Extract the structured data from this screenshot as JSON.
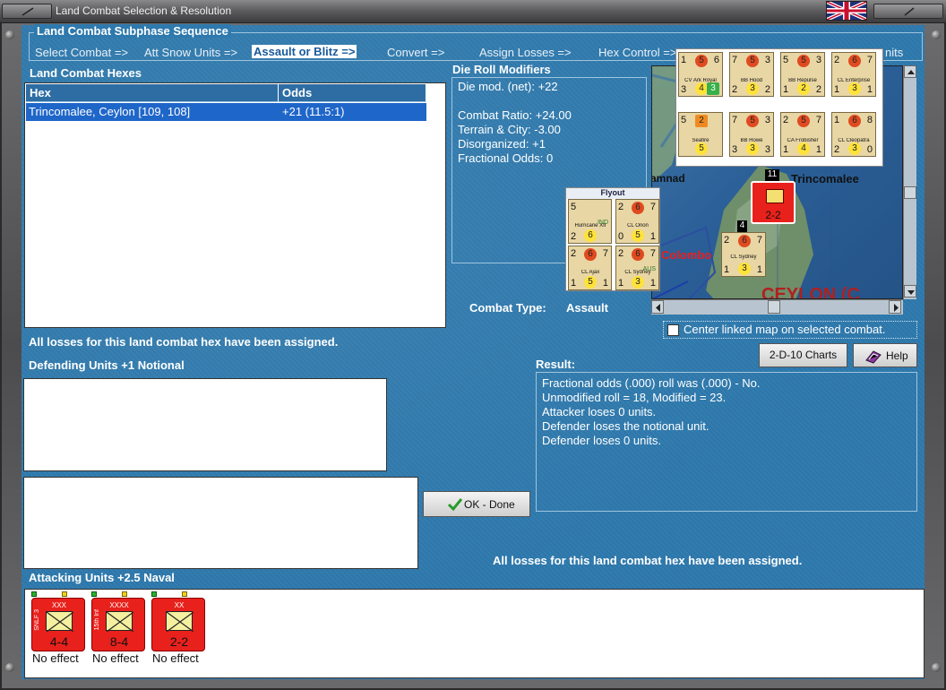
{
  "window": {
    "title": "Land Combat Selection & Resolution"
  },
  "subphase": {
    "title": "Land Combat Subphase Sequence",
    "steps": [
      "Select Combat =>",
      "Att Snow Units =>",
      "Assault or Blitz =>",
      "Convert =>",
      "Assign Losses =>",
      "Hex Control =>",
      "nits"
    ]
  },
  "hexes": {
    "title": "Land Combat Hexes",
    "columns": [
      "Hex",
      "Odds"
    ],
    "rows": [
      {
        "hex": "Trincomalee, Ceylon [109, 108]",
        "odds": "+21 (11.5:1)"
      }
    ]
  },
  "modifiers": {
    "title": "Die Roll Modifiers",
    "lines": [
      "Die mod. (net): +22",
      "",
      "Combat Ratio: +24.00",
      "Terrain & City: -3.00",
      "Disorganized: +1",
      "Fractional Odds: 0"
    ]
  },
  "combat_type": {
    "label": "Combat Type:",
    "value": "Assault"
  },
  "map": {
    "labels": {
      "trincomalee": "Trincomalee",
      "colombo": "Colombo",
      "jaffna": "amnad",
      "ceylon": "CEYLON (C"
    },
    "stack_counts": {
      "top": "11",
      "mid": "4"
    },
    "city_counter": {
      "value": "2-2"
    },
    "sydney_counter": {
      "left": "2",
      "center": "6",
      "right": "7",
      "name": "CL Sydney",
      "bottom_left": "1",
      "bottom_center": "3",
      "bottom_right": "1",
      "tag": "AUS"
    },
    "flyout": {
      "title": "Flyout",
      "counters": [
        {
          "name": "Hurricane XII",
          "tl": "5",
          "tc": "",
          "tr": "",
          "bl": "2",
          "bc": "6",
          "br": "",
          "tag": "IND"
        },
        {
          "name": "CL Orion",
          "tl": "2",
          "tc": "6",
          "tr": "7",
          "bl": "0",
          "bc": "5",
          "br": "1",
          "tag": ""
        },
        {
          "name": "CL Ajax",
          "tl": "2",
          "tc": "6",
          "tr": "7",
          "bl": "1",
          "bc": "5",
          "br": "1",
          "tag": ""
        },
        {
          "name": "CL Sydney",
          "tl": "2",
          "tc": "6",
          "tr": "7",
          "bl": "1",
          "bc": "3",
          "br": "1",
          "tag": "AUS"
        }
      ]
    },
    "naval": [
      {
        "name": "CV Ark Royal",
        "tl": "1",
        "tc": "5",
        "tr": "6",
        "bl": "3",
        "bc": "4",
        "br": "3"
      },
      {
        "name": "BB Hood",
        "tl": "7",
        "tc": "5",
        "tr": "3",
        "bl": "2",
        "bc": "3",
        "br": "2"
      },
      {
        "name": "BB Repulse",
        "tl": "5",
        "tc": "5",
        "tr": "3",
        "bl": "1",
        "bc": "2",
        "br": "2"
      },
      {
        "name": "CL Enterprise",
        "tl": "2",
        "tc": "6",
        "tr": "7",
        "bl": "1",
        "bc": "3",
        "br": "1"
      },
      {
        "name": "Seafire",
        "tl": "5",
        "tc": "2",
        "tr": "",
        "bl": "",
        "bc": "5",
        "br": ""
      },
      {
        "name": "BB Howe",
        "tl": "7",
        "tc": "5",
        "tr": "3",
        "bl": "3",
        "bc": "3",
        "br": "3"
      },
      {
        "name": "CA Frobisher",
        "tl": "2",
        "tc": "5",
        "tr": "7",
        "bl": "1",
        "bc": "4",
        "br": "1"
      },
      {
        "name": "CL Cleopatra",
        "tl": "1",
        "tc": "6",
        "tr": "8",
        "bl": "2",
        "bc": "3",
        "br": "0"
      }
    ],
    "center_linked_label": "Center linked map on selected combat."
  },
  "status": {
    "losses_assigned_top": "All losses for this land combat hex have been assigned.",
    "losses_assigned_bottom": "All losses for this land combat hex have been assigned."
  },
  "defending": {
    "title": "Defending Units +1 Notional"
  },
  "attacking": {
    "title": "Attacking Units +2.5 Naval",
    "units": [
      {
        "size": "XXX",
        "side": "SNLF 3",
        "strength": "4-4",
        "result": "No effect"
      },
      {
        "size": "XXXX",
        "side": "15th Inf",
        "strength": "8-4",
        "result": "No effect"
      },
      {
        "size": "XX",
        "side": "",
        "strength": "2-2",
        "result": "No effect"
      }
    ]
  },
  "buttons": {
    "charts": "2-D-10 Charts",
    "help": "Help",
    "ok": "OK - Done"
  },
  "result": {
    "title": "Result:",
    "lines": [
      "Fractional odds (.000) roll was (.000)  - No.",
      "Unmodified roll = 18, Modified = 23.",
      "Attacker loses 0 units.",
      "Defender loses the notional unit.",
      "Defender loses 0 units."
    ]
  },
  "colors": {
    "panel": "#2e79ad",
    "selection": "#1f66c9",
    "unit_red": "#e8211c"
  }
}
